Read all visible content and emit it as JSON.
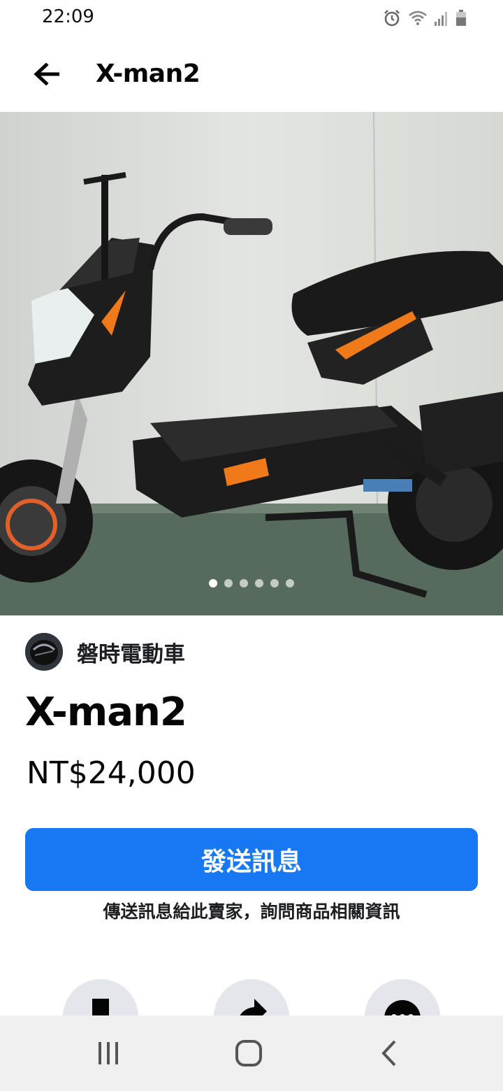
{
  "status_bar": {
    "time": "22:09",
    "icons": [
      "alarm-icon",
      "wifi-icon",
      "signal-icon",
      "battery-icon"
    ]
  },
  "app_bar": {
    "back_icon": "arrow-left-icon",
    "title": "X-man2"
  },
  "photo_carousel": {
    "image": "black electric scooter with orange accents",
    "total_photos": 6,
    "active_index": 0
  },
  "seller": {
    "name": "磐時電動車"
  },
  "listing": {
    "title": "X-man2",
    "price": "NT$24,000"
  },
  "message": {
    "button_label": "發送訊息",
    "hint": "傳送訊息給此賣家，詢問商品相關資訊"
  },
  "actions": [
    {
      "icon": "save-icon"
    },
    {
      "icon": "share-icon"
    },
    {
      "icon": "more-icon"
    }
  ],
  "system_nav": {
    "icons": [
      "recent-apps-icon",
      "home-icon",
      "back-icon"
    ]
  },
  "colors": {
    "accent": "#1877f2",
    "scooter_accent": "#f07a1a",
    "nav_background": "#f0f0f0",
    "action_circle": "#e4e6eb"
  }
}
